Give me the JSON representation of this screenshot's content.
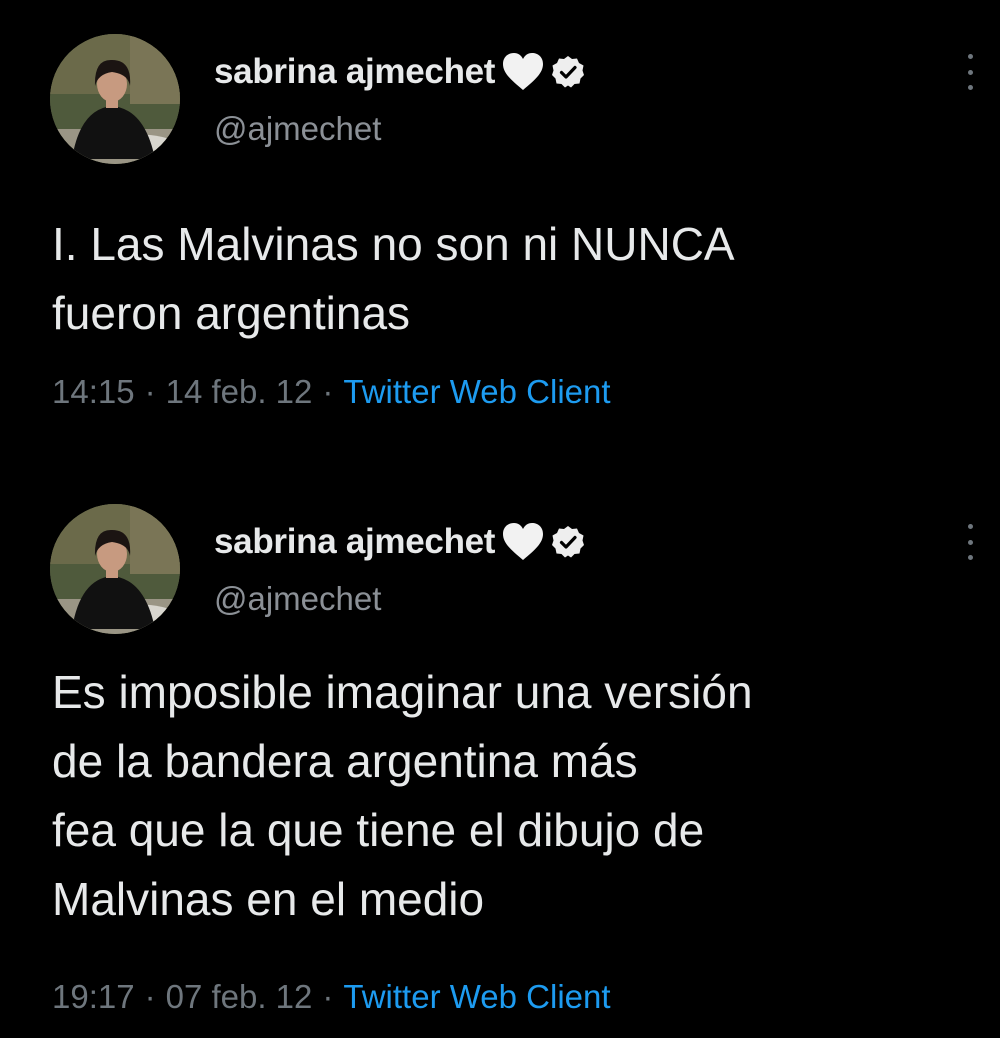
{
  "accent_color": "#1d9bf0",
  "tweets": [
    {
      "display_name": "sabrina ajmechet",
      "name_emoji_icon": "white-heart-icon",
      "badge_icon": "verified-badge-icon",
      "handle": "@ajmechet",
      "text_lines": [
        "I. Las Malvinas no son ni NUNCA",
        "fueron argentinas"
      ],
      "time": "14:15",
      "date": "14 feb. 12",
      "separator": "·",
      "client": "Twitter Web Client"
    },
    {
      "display_name": "sabrina ajmechet",
      "name_emoji_icon": "white-heart-icon",
      "badge_icon": "verified-badge-icon",
      "handle": "@ajmechet",
      "text_lines": [
        "Es imposible imaginar una versión",
        "de la bandera argentina más",
        "fea que la que tiene el dibujo de",
        "Malvinas en el medio"
      ],
      "time": "19:17",
      "date": "07 feb. 12",
      "separator": "·",
      "client": "Twitter Web Client"
    }
  ]
}
